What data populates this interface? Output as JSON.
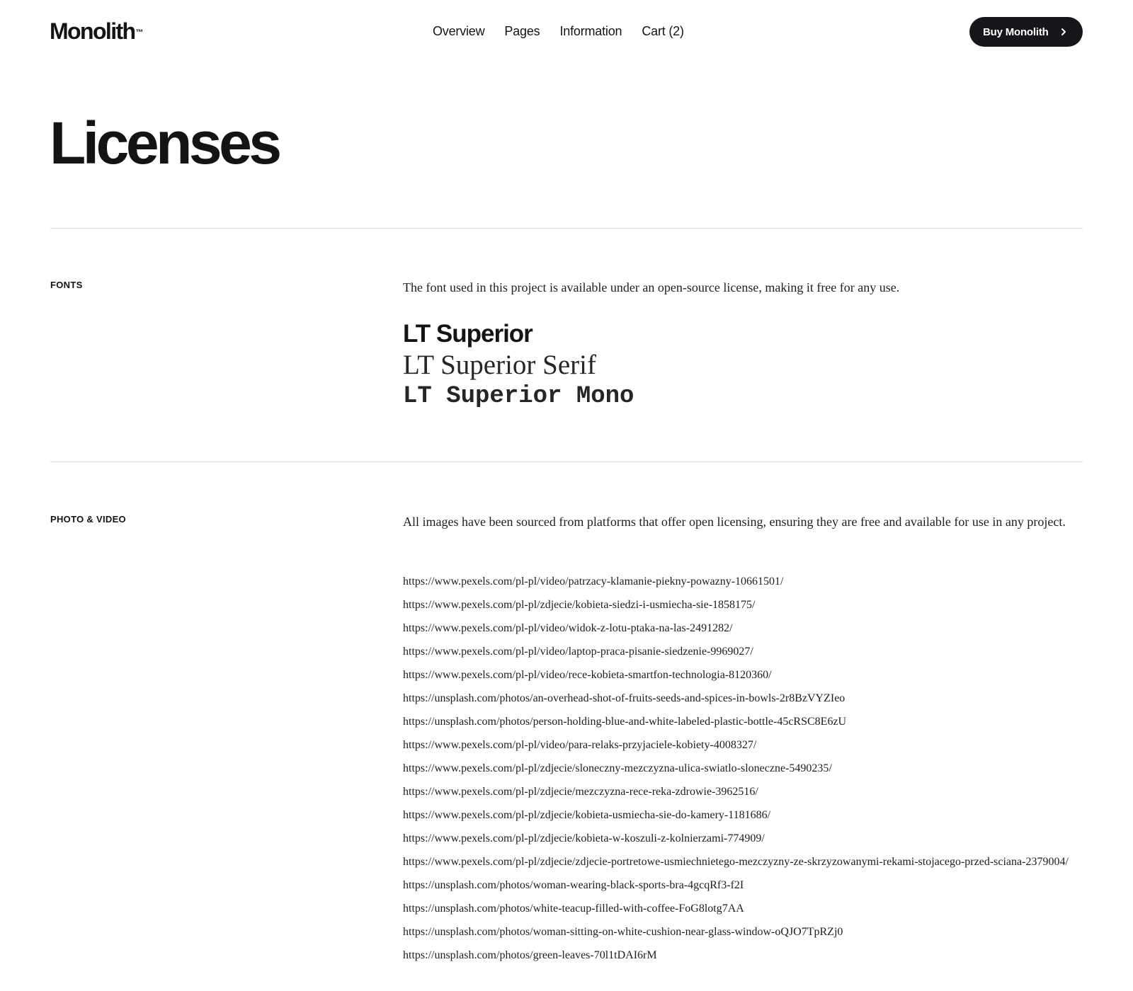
{
  "header": {
    "logo": "Monolith",
    "logo_mark": "™",
    "nav": [
      "Overview",
      "Pages",
      "Information",
      "Cart (2)"
    ],
    "buy_label": "Buy Monolith",
    "buy_icon": "chevron-right-icon"
  },
  "page": {
    "title": "Licenses"
  },
  "fonts": {
    "label": "FONTS",
    "intro": "The font used in this project is available under an open-source license, making it free for any use.",
    "samples": [
      "LT Superior",
      "LT Superior Serif",
      "LT Superior Mono"
    ]
  },
  "photo_video": {
    "label": "PHOTO & VIDEO",
    "intro": "All images have been sourced from platforms that offer open licensing, ensuring they are free and available for use in any project.",
    "links": [
      "https://www.pexels.com/pl-pl/video/patrzacy-klamanie-piekny-powazny-10661501/",
      "https://www.pexels.com/pl-pl/zdjecie/kobieta-siedzi-i-usmiecha-sie-1858175/",
      "https://www.pexels.com/pl-pl/video/widok-z-lotu-ptaka-na-las-2491282/",
      "https://www.pexels.com/pl-pl/video/laptop-praca-pisanie-siedzenie-9969027/",
      "https://www.pexels.com/pl-pl/video/rece-kobieta-smartfon-technologia-8120360/",
      "https://unsplash.com/photos/an-overhead-shot-of-fruits-seeds-and-spices-in-bowls-2r8BzVYZIeo",
      "https://unsplash.com/photos/person-holding-blue-and-white-labeled-plastic-bottle-45cRSC8E6zU",
      "https://www.pexels.com/pl-pl/video/para-relaks-przyjaciele-kobiety-4008327/",
      "https://www.pexels.com/pl-pl/zdjecie/sloneczny-mezczyzna-ulica-swiatlo-sloneczne-5490235/",
      "https://www.pexels.com/pl-pl/zdjecie/mezczyzna-rece-reka-zdrowie-3962516/",
      "https://www.pexels.com/pl-pl/zdjecie/kobieta-usmiecha-sie-do-kamery-1181686/",
      "https://www.pexels.com/pl-pl/zdjecie/kobieta-w-koszuli-z-kolnierzami-774909/",
      "https://www.pexels.com/pl-pl/zdjecie/zdjecie-portretowe-usmiechnietego-mezczyzny-ze-skrzyzowanymi-rekami-stojacego-przed-sciana-2379004/",
      "https://unsplash.com/photos/woman-wearing-black-sports-bra-4gcqRf3-f2I",
      "https://unsplash.com/photos/white-teacup-filled-with-coffee-FoG8lotg7AA",
      "https://unsplash.com/photos/woman-sitting-on-white-cushion-near-glass-window-oQJO7TpRZj0",
      "https://unsplash.com/photos/green-leaves-70l1tDAI6rM"
    ]
  }
}
